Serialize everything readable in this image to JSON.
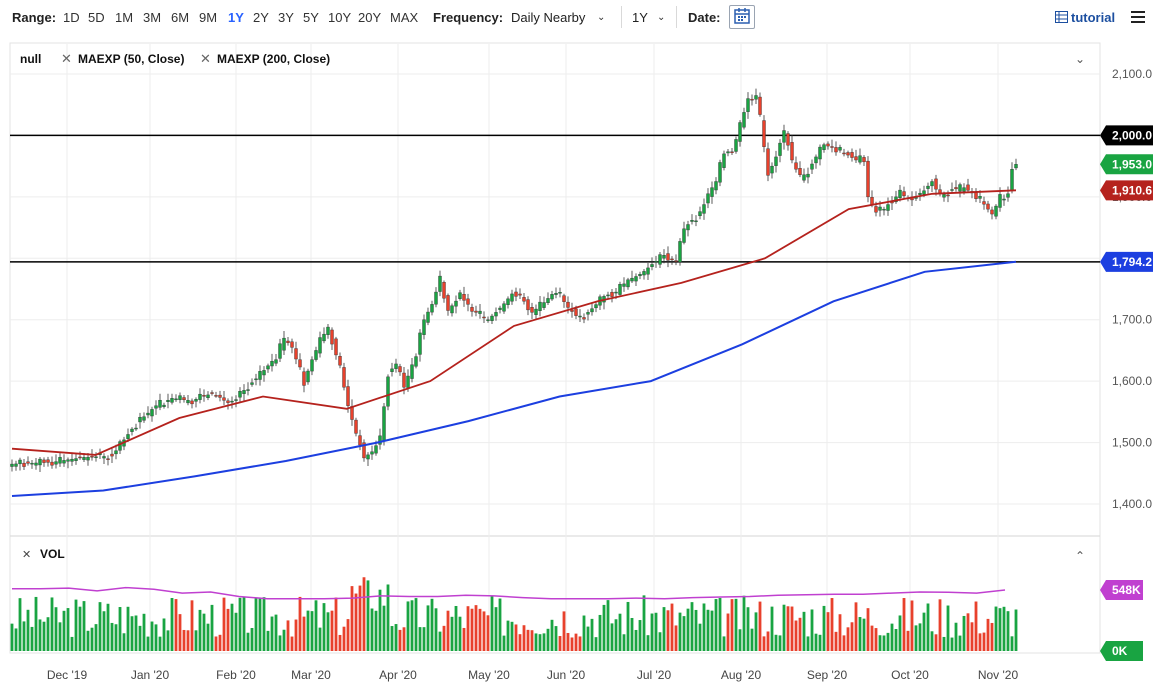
{
  "toolbar": {
    "range_label": "Range:",
    "ranges": [
      "1D",
      "5D",
      "1M",
      "3M",
      "6M",
      "9M",
      "1Y",
      "2Y",
      "3Y",
      "5Y",
      "10Y",
      "20Y",
      "MAX"
    ],
    "active_range": "1Y",
    "frequency_label": "Frequency:",
    "frequency_value": "Daily Nearby",
    "period_value": "1Y",
    "date_label": "Date:",
    "tutorial_label": "tutorial"
  },
  "legend": {
    "symbol": "null",
    "study1": "MAEXP (50, Close)",
    "study2": "MAEXP (200, Close)"
  },
  "vol_label": "VOL",
  "colors": {
    "up": "#19a442",
    "down": "#e8412c",
    "ma50": "#b5221d",
    "ma200": "#1c3fe0",
    "vol_ma": "#c040d0",
    "active": "#2962ff"
  },
  "chart_data": {
    "type": "candlestick",
    "price_axis": {
      "ticks": [
        "1,400.0",
        "1,500.0",
        "1,600.0",
        "1,700.0",
        "1,800.0",
        "1,900.0",
        "2,000.0",
        "2,100.0"
      ],
      "range": [
        1355,
        2120
      ]
    },
    "x_axis_labels": [
      "Dec '19",
      "Jan '20",
      "Feb '20",
      "Mar '20",
      "Apr '20",
      "May '20",
      "Jun '20",
      "Jul '20",
      "Aug '20",
      "Sep '20",
      "Oct '20",
      "Nov '20"
    ],
    "horizontal_lines": [
      2000.0,
      1794.2
    ],
    "price_badges": [
      {
        "label": "2,000.0",
        "value": 2000.0,
        "kind": "hline"
      },
      {
        "label": "1,953.0",
        "value": 1953.0,
        "kind": "last"
      },
      {
        "label": "1,910.6",
        "value": 1910.6,
        "kind": "ma50"
      },
      {
        "label": "1,794.2",
        "value": 1794.2,
        "kind": "ma200"
      }
    ],
    "close_anchors": [
      [
        0,
        1465
      ],
      [
        10,
        1468
      ],
      [
        18,
        1476
      ],
      [
        25,
        1478
      ],
      [
        30,
        1522
      ],
      [
        33,
        1542
      ],
      [
        36,
        1560
      ],
      [
        40,
        1572
      ],
      [
        45,
        1568
      ],
      [
        50,
        1580
      ],
      [
        54,
        1565
      ],
      [
        56,
        1570
      ],
      [
        58,
        1585
      ],
      [
        62,
        1610
      ],
      [
        66,
        1640
      ],
      [
        68,
        1670
      ],
      [
        70,
        1655
      ],
      [
        73,
        1598
      ],
      [
        75,
        1635
      ],
      [
        77,
        1665
      ],
      [
        79,
        1688
      ],
      [
        82,
        1620
      ],
      [
        84,
        1560
      ],
      [
        86,
        1515
      ],
      [
        88,
        1475
      ],
      [
        90,
        1485
      ],
      [
        92,
        1505
      ],
      [
        94,
        1612
      ],
      [
        96,
        1628
      ],
      [
        98,
        1590
      ],
      [
        101,
        1645
      ],
      [
        103,
        1700
      ],
      [
        105,
        1725
      ],
      [
        107,
        1765
      ],
      [
        109,
        1715
      ],
      [
        112,
        1738
      ],
      [
        116,
        1712
      ],
      [
        119,
        1700
      ],
      [
        122,
        1718
      ],
      [
        125,
        1742
      ],
      [
        128,
        1730
      ],
      [
        130,
        1712
      ],
      [
        133,
        1728
      ],
      [
        136,
        1748
      ],
      [
        139,
        1720
      ],
      [
        142,
        1700
      ],
      [
        145,
        1718
      ],
      [
        148,
        1738
      ],
      [
        151,
        1745
      ],
      [
        154,
        1765
      ],
      [
        157,
        1773
      ],
      [
        160,
        1790
      ],
      [
        163,
        1805
      ],
      [
        166,
        1795
      ],
      [
        168,
        1848
      ],
      [
        170,
        1862
      ],
      [
        172,
        1870
      ],
      [
        174,
        1905
      ],
      [
        176,
        1925
      ],
      [
        178,
        1975
      ],
      [
        180,
        1972
      ],
      [
        182,
        2015
      ],
      [
        184,
        2060
      ],
      [
        186,
        2065
      ],
      [
        187,
        2028
      ],
      [
        189,
        1935
      ],
      [
        191,
        1965
      ],
      [
        193,
        2008
      ],
      [
        195,
        1960
      ],
      [
        197,
        1930
      ],
      [
        199,
        1942
      ],
      [
        201,
        1965
      ],
      [
        203,
        1985
      ],
      [
        206,
        1978
      ],
      [
        209,
        1968
      ],
      [
        211,
        1960
      ],
      [
        213,
        1962
      ],
      [
        214,
        1900
      ],
      [
        216,
        1875
      ],
      [
        218,
        1880
      ],
      [
        220,
        1895
      ],
      [
        222,
        1905
      ],
      [
        225,
        1895
      ],
      [
        228,
        1910
      ],
      [
        230,
        1925
      ],
      [
        232,
        1900
      ],
      [
        235,
        1912
      ],
      [
        238,
        1915
      ],
      [
        241,
        1902
      ],
      [
        243,
        1888
      ],
      [
        245,
        1872
      ],
      [
        247,
        1898
      ],
      [
        249,
        1905
      ],
      [
        250,
        1945
      ],
      [
        251,
        1953
      ]
    ],
    "volume_axis": {
      "labels": [
        "548K",
        "0K"
      ]
    },
    "series": [
      {
        "name": "MAEXP (50, Close)",
        "values": [
          1490,
          1480,
          1540,
          1575,
          1555,
          1600,
          1690,
          1730,
          1760,
          1800,
          1880,
          1905,
          1910.6
        ]
      },
      {
        "name": "MAEXP (200, Close)",
        "values": [
          1413,
          1422,
          1445,
          1470,
          1500,
          1535,
          1575,
          1600,
          1660,
          1730,
          1778,
          1794.2
        ]
      }
    ]
  }
}
